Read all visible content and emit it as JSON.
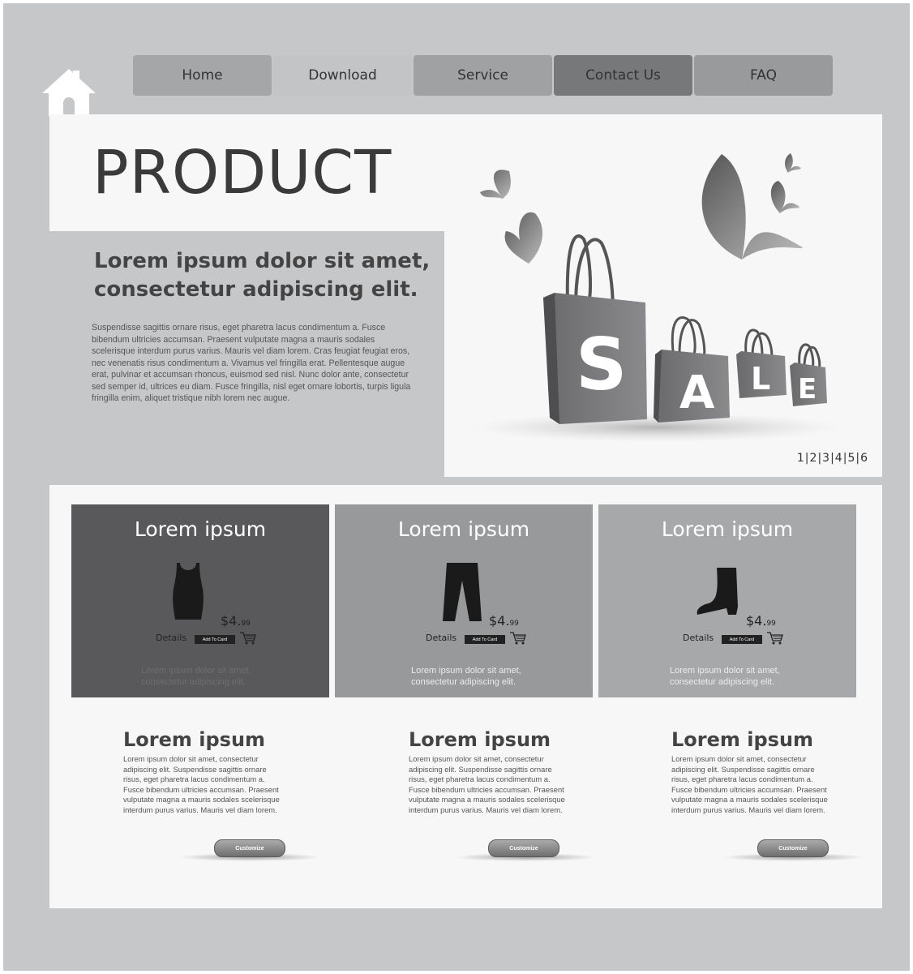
{
  "nav": {
    "items": [
      {
        "label": "Home",
        "color": "#a5a6a8"
      },
      {
        "label": "Download",
        "color": "#c3c4c6"
      },
      {
        "label": "Service",
        "color": "#a0a1a3"
      },
      {
        "label": "Contact Us",
        "color": "#77787a"
      },
      {
        "label": "FAQ",
        "color": "#999a9c"
      }
    ]
  },
  "hero": {
    "title": "PRODUCT",
    "heading": "Lorem ipsum dolor sit amet, consectetur adipiscing elit.",
    "body": "Suspendisse sagittis ornare risus, eget pharetra lacus condimentum a. Fusce bibendum ultricies accumsan. Praesent vulputate magna a mauris sodales scelerisque interdum purus varius. Mauris vel diam lorem. Cras feugiat feugiat eros, nec venenatis risus condimentum a. Vivamus vel fringilla erat. Pellentesque augue erat, pulvinar et accumsan rhoncus, euismod sed nisl. Nunc dolor ante, consectetur sed semper id, ultrices eu diam. Fusce fringilla, nisl eget ornare lobortis, turpis ligula fringilla enim, aliquet tristique nibh lorem nec augue.",
    "sale_letters": [
      "S",
      "A",
      "L",
      "E"
    ],
    "pager": [
      "1",
      "2",
      "3",
      "4",
      "5",
      "6"
    ]
  },
  "products": [
    {
      "title": "Lorem ipsum",
      "icon": "tank-top-icon",
      "price_main": "$4.",
      "price_cents": "99",
      "details": "Details",
      "cart_label": "Add To Card",
      "desc": "Lorem ipsum dolor sit amet, consectetur adipiscing elit.",
      "bg": "#59595b"
    },
    {
      "title": "Lorem ipsum",
      "icon": "trousers-icon",
      "price_main": "$4.",
      "price_cents": "99",
      "details": "Details",
      "cart_label": "Add To Card",
      "desc": "Lorem ipsum dolor sit amet, consectetur adipiscing elit.",
      "bg": "#98999b"
    },
    {
      "title": "Lorem ipsum",
      "icon": "boot-icon",
      "price_main": "$4.",
      "price_cents": "99",
      "details": "Details",
      "cart_label": "Add To Card",
      "desc": "Lorem ipsum dolor sit amet, consectetur adipiscing elit.",
      "bg": "#a7a8aa"
    }
  ],
  "columns": [
    {
      "title": "Lorem ipsum",
      "body": "Lorem ipsum dolor sit amet, consectetur adipiscing elit. Suspendisse sagittis ornare risus, eget pharetra lacus condimentum a. Fusce bibendum ultricies accumsan. Praesent vulputate magna a mauris sodales scelerisque interdum purus varius. Mauris vel diam lorem.",
      "button": "Customize"
    },
    {
      "title": "Lorem ipsum",
      "body": "Lorem ipsum dolor sit amet, consectetur adipiscing elit. Suspendisse sagittis ornare risus, eget pharetra lacus condimentum a. Fusce bibendum ultricies accumsan. Praesent vulputate magna a mauris sodales scelerisque interdum purus varius. Mauris vel diam lorem.",
      "button": "Customize"
    },
    {
      "title": "Lorem ipsum",
      "body": "Lorem ipsum dolor sit amet, consectetur adipiscing elit. Suspendisse sagittis ornare risus, eget pharetra lacus condimentum a. Fusce bibendum ultricies accumsan. Praesent vulputate magna a mauris sodales scelerisque interdum purus varius. Mauris vel diam lorem.",
      "button": "Customize"
    }
  ]
}
